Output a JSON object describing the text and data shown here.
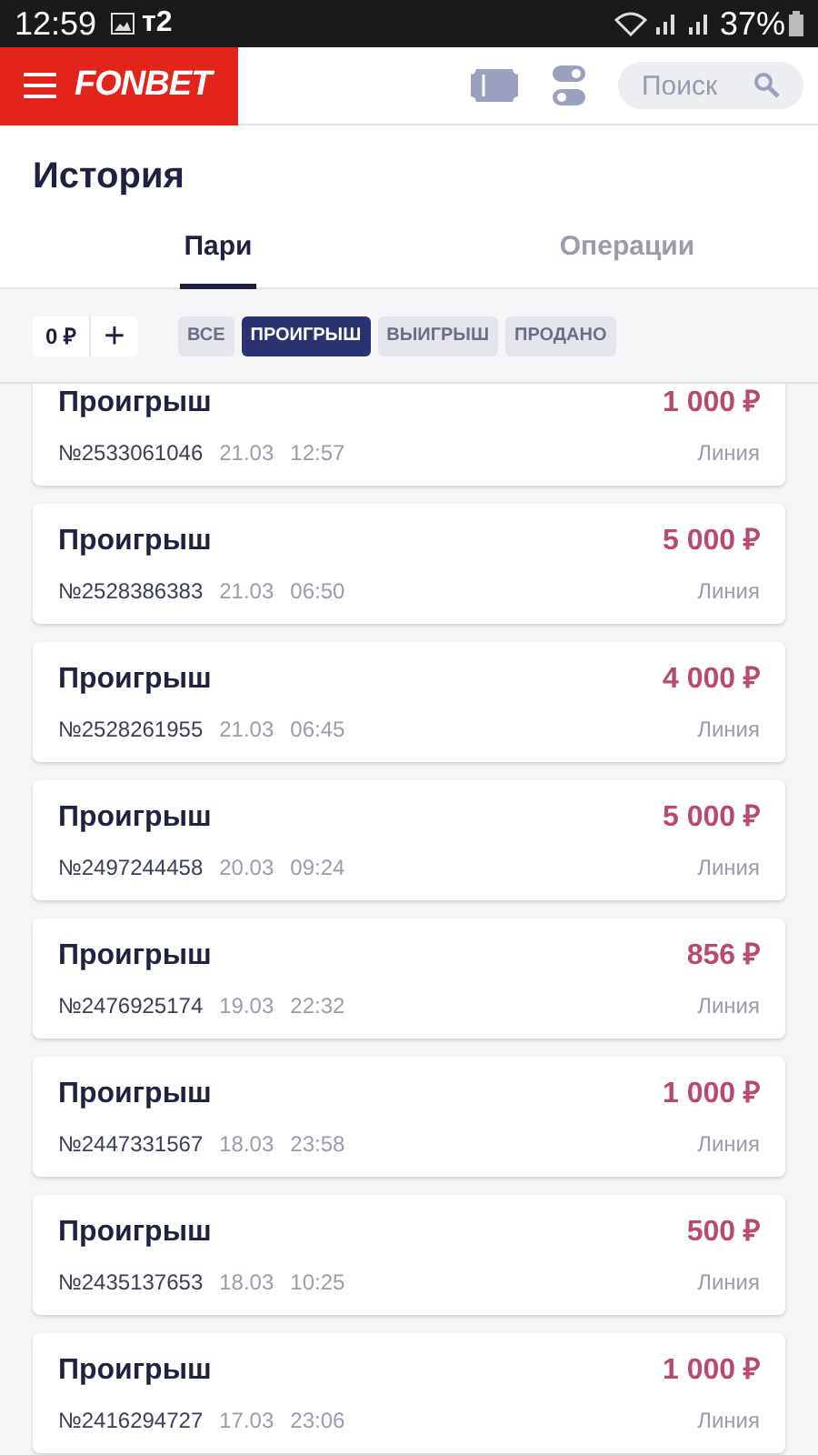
{
  "status_bar": {
    "time": "12:59",
    "carrier": "т2",
    "battery": "37%"
  },
  "header": {
    "logo": "FONBET",
    "search": {
      "placeholder": "Поиск"
    }
  },
  "title": "История",
  "tabs": [
    {
      "label": "Пари",
      "selected": true
    },
    {
      "label": "Операции",
      "selected": false
    }
  ],
  "balance": {
    "value": "0 ₽",
    "add": "+"
  },
  "filters": [
    {
      "label": "ВСЕ",
      "selected": false
    },
    {
      "label": "ПРОИГРЫШ",
      "selected": true
    },
    {
      "label": "ВЫИГРЫШ",
      "selected": false
    },
    {
      "label": "ПРОДАНО",
      "selected": false
    }
  ],
  "bets": [
    {
      "status": "Проигрыш",
      "number": "№2533061046",
      "date": "21.03",
      "time": "12:57",
      "amount": "1 000 ₽",
      "type": "Линия"
    },
    {
      "status": "Проигрыш",
      "number": "№2528386383",
      "date": "21.03",
      "time": "06:50",
      "amount": "5 000 ₽",
      "type": "Линия"
    },
    {
      "status": "Проигрыш",
      "number": "№2528261955",
      "date": "21.03",
      "time": "06:45",
      "amount": "4 000 ₽",
      "type": "Линия"
    },
    {
      "status": "Проигрыш",
      "number": "№2497244458",
      "date": "20.03",
      "time": "09:24",
      "amount": "5 000 ₽",
      "type": "Линия"
    },
    {
      "status": "Проигрыш",
      "number": "№2476925174",
      "date": "19.03",
      "time": "22:32",
      "amount": "856 ₽",
      "type": "Линия"
    },
    {
      "status": "Проигрыш",
      "number": "№2447331567",
      "date": "18.03",
      "time": "23:58",
      "amount": "1 000 ₽",
      "type": "Линия"
    },
    {
      "status": "Проигрыш",
      "number": "№2435137653",
      "date": "18.03",
      "time": "10:25",
      "amount": "500 ₽",
      "type": "Линия"
    },
    {
      "status": "Проигрыш",
      "number": "№2416294727",
      "date": "17.03",
      "time": "23:06",
      "amount": "1 000 ₽",
      "type": "Линия"
    }
  ]
}
